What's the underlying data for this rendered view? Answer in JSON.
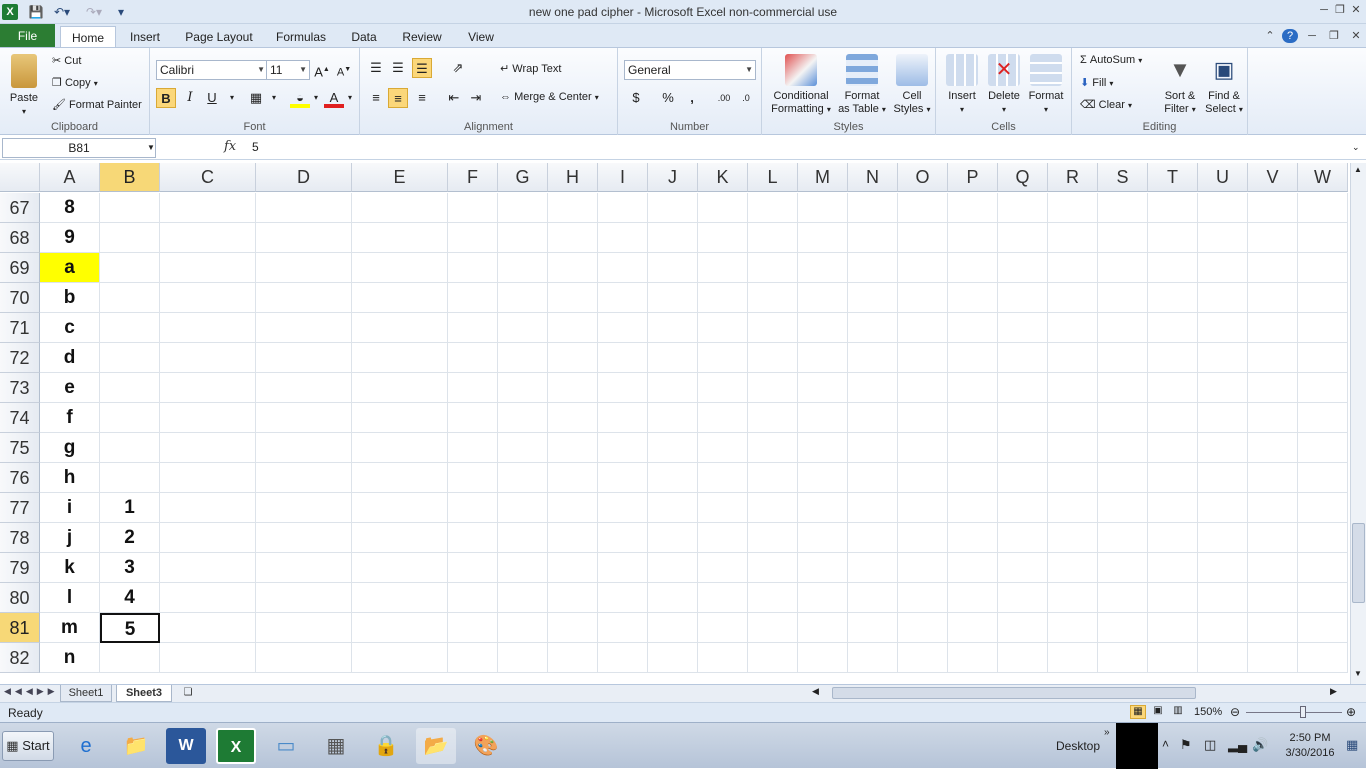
{
  "window": {
    "title": "new one pad cipher  -  Microsoft Excel non-commercial use"
  },
  "tabs": [
    "File",
    "Home",
    "Insert",
    "Page Layout",
    "Formulas",
    "Data",
    "Review",
    "View"
  ],
  "clipboard": {
    "paste": "Paste",
    "cut": "Cut",
    "copy": "Copy",
    "format_painter": "Format Painter",
    "label": "Clipboard"
  },
  "font": {
    "name": "Calibri",
    "size": "11",
    "label": "Font",
    "bold": "B",
    "italic": "I",
    "underline": "U"
  },
  "alignment": {
    "wrap": "Wrap Text",
    "merge": "Merge & Center",
    "label": "Alignment"
  },
  "number": {
    "format": "General",
    "label": "Number",
    "currency": "$",
    "percent": "%",
    "comma": ","
  },
  "styles": {
    "conditional": "Conditional",
    "conditional2": "Formatting",
    "table": "Format",
    "table2": "as Table",
    "cell": "Cell",
    "cell2": "Styles",
    "label": "Styles"
  },
  "cells": {
    "insert": "Insert",
    "delete": "Delete",
    "format": "Format",
    "label": "Cells"
  },
  "editing": {
    "autosum": "AutoSum",
    "fill": "Fill",
    "clear": "Clear",
    "sort": "Sort &",
    "sort2": "Filter",
    "find": "Find &",
    "find2": "Select",
    "label": "Editing"
  },
  "formula_bar": {
    "name_box": "B81",
    "fx": "fx",
    "value": "5"
  },
  "columns": [
    "A",
    "B",
    "C",
    "D",
    "E",
    "F",
    "G",
    "H",
    "I",
    "J",
    "K",
    "L",
    "M",
    "N",
    "O",
    "P",
    "Q",
    "R",
    "S",
    "T",
    "U",
    "V",
    "W"
  ],
  "rows": [
    {
      "n": "67",
      "a": "8",
      "b": ""
    },
    {
      "n": "68",
      "a": "9",
      "b": ""
    },
    {
      "n": "69",
      "a": "a",
      "b": ""
    },
    {
      "n": "70",
      "a": "b",
      "b": ""
    },
    {
      "n": "71",
      "a": "c",
      "b": ""
    },
    {
      "n": "72",
      "a": "d",
      "b": ""
    },
    {
      "n": "73",
      "a": "e",
      "b": ""
    },
    {
      "n": "74",
      "a": "f",
      "b": ""
    },
    {
      "n": "75",
      "a": "g",
      "b": ""
    },
    {
      "n": "76",
      "a": "h",
      "b": ""
    },
    {
      "n": "77",
      "a": "i",
      "b": "1"
    },
    {
      "n": "78",
      "a": "j",
      "b": "2"
    },
    {
      "n": "79",
      "a": "k",
      "b": "3"
    },
    {
      "n": "80",
      "a": "l",
      "b": "4"
    },
    {
      "n": "81",
      "a": "m",
      "b": "5"
    },
    {
      "n": "82",
      "a": "n",
      "b": ""
    }
  ],
  "highlight_color": "#ffff00",
  "sheets": [
    "Sheet1",
    "Sheet3"
  ],
  "status": {
    "ready": "Ready",
    "zoom": "150%"
  },
  "taskbar": {
    "start": "Start",
    "desktop": "Desktop",
    "time": "2:50 PM",
    "date": "3/30/2016"
  }
}
